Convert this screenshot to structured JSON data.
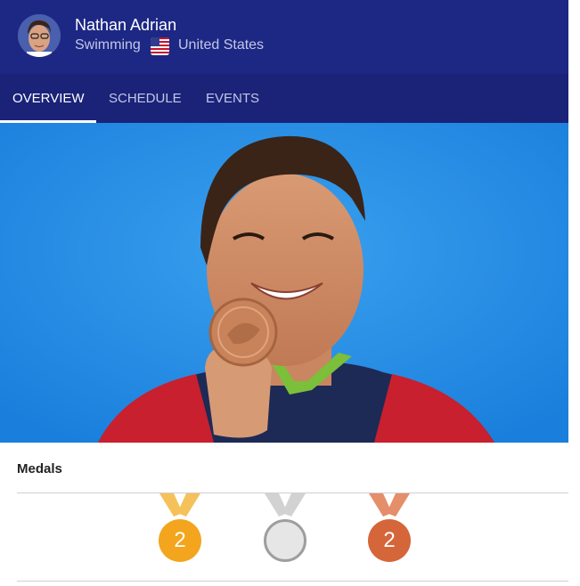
{
  "header": {
    "athlete_name": "Nathan Adrian",
    "sport": "Swimming",
    "country": "United States",
    "flag_icon": "us-flag-icon",
    "background_color": "#1d2884"
  },
  "tabs": [
    {
      "label": "OVERVIEW",
      "active": true
    },
    {
      "label": "SCHEDULE",
      "active": false
    },
    {
      "label": "EVENTS",
      "active": false
    }
  ],
  "medals": {
    "title": "Medals",
    "gold": {
      "count": "2",
      "color": "#f2a51d"
    },
    "silver": {
      "count": "",
      "color": "#9e9e9e"
    },
    "bronze": {
      "count": "2",
      "color": "#d4663a"
    }
  }
}
